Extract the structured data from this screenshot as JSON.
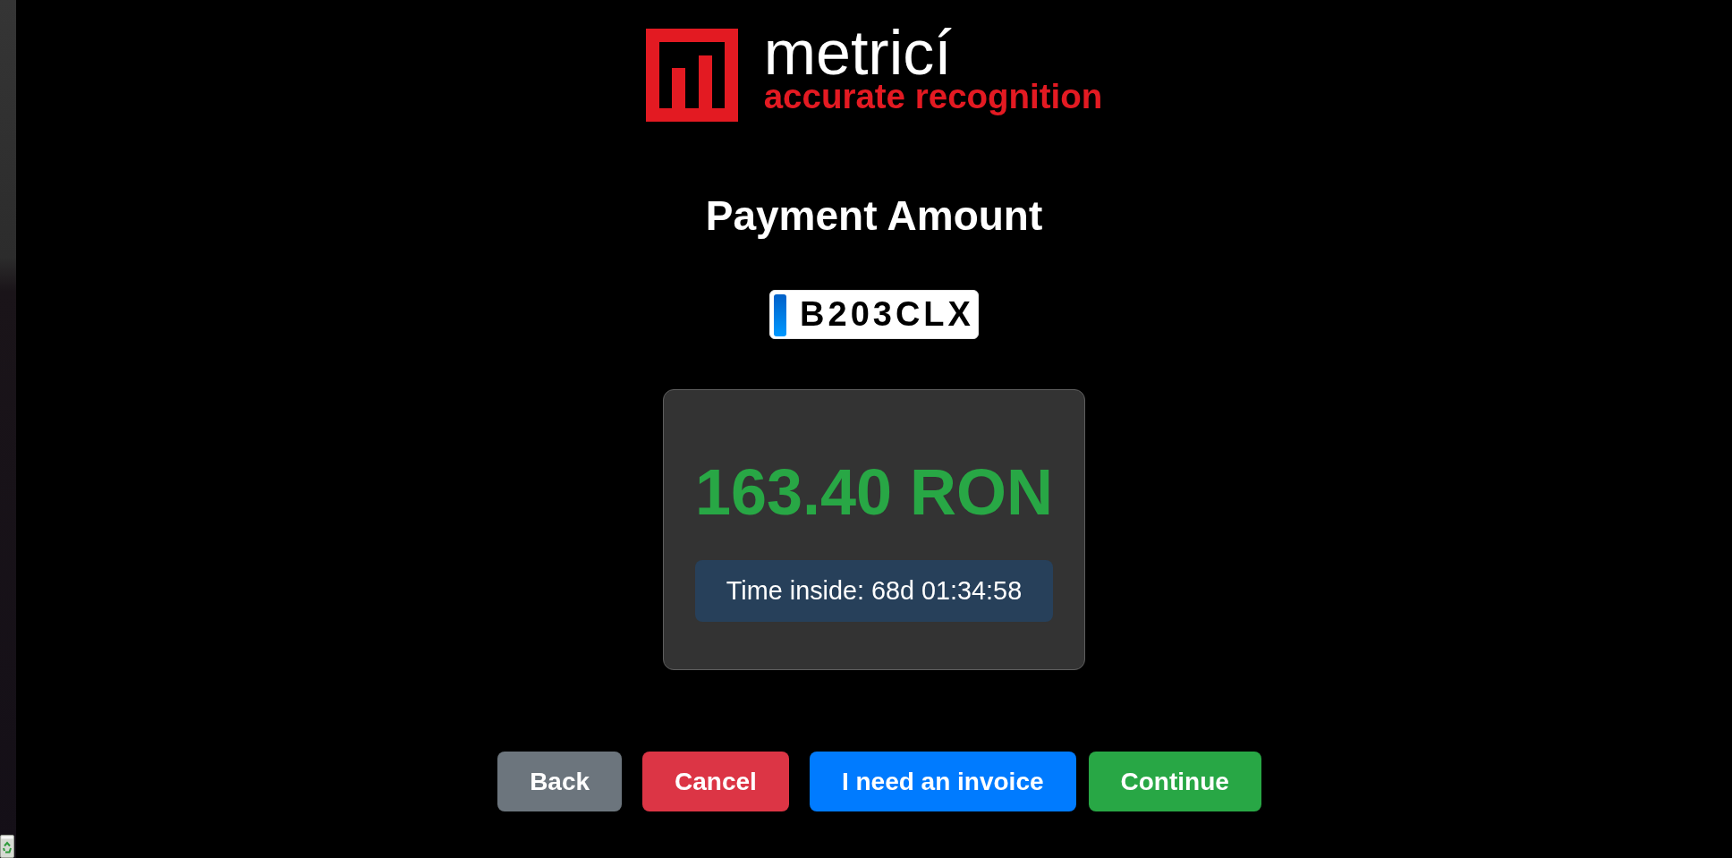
{
  "logo": {
    "wordmark": "metricí",
    "tagline": "accurate recognition"
  },
  "title": "Payment Amount",
  "plate": {
    "number": "B203CLX"
  },
  "payment": {
    "amount": "163.40 RON",
    "time_inside": "Time inside: 68d 01:34:58"
  },
  "buttons": [
    {
      "label": "Back",
      "kind": "secondary"
    },
    {
      "label": "Cancel",
      "kind": "danger"
    },
    {
      "label": "I need an invoice",
      "kind": "primary"
    },
    {
      "label": "Continue",
      "kind": "success"
    }
  ]
}
